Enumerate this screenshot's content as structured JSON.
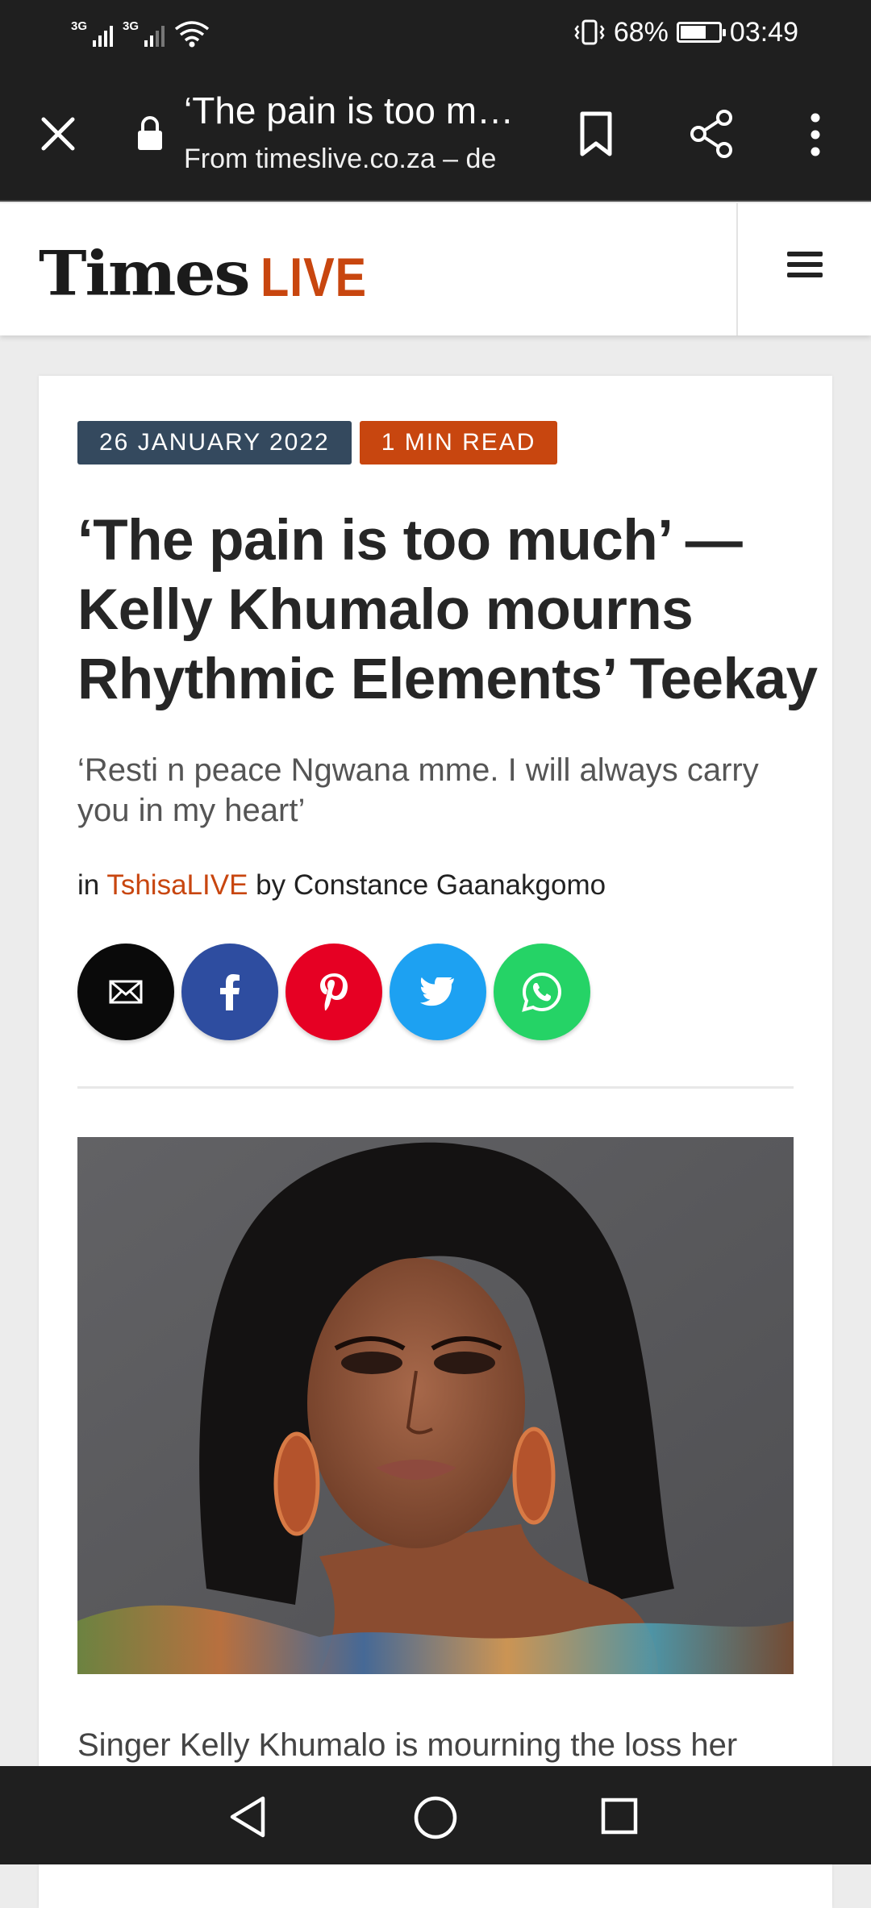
{
  "status_bar": {
    "signal1_label": "3G",
    "signal2_label": "3G",
    "battery_percent": "68%",
    "battery_level": 0.68,
    "time": "03:49",
    "icons": [
      "vibrate-icon",
      "battery-icon",
      "wifi-icon"
    ]
  },
  "browser": {
    "title": "‘The pain is too much’ — Kelly Khumalo mourns Rhythmic Elements’ Teekay",
    "url": "From timeslive.co.za – de",
    "icons": [
      "close-icon",
      "lock-icon",
      "bookmark-icon",
      "share-icon",
      "more-vert-icon"
    ]
  },
  "site": {
    "logo_times": "Times",
    "logo_live": "LIVE",
    "menu_icon": "hamburger-menu-icon"
  },
  "article": {
    "date_tag": "26 JANUARY 2022",
    "read_tag": "1 MIN READ",
    "headline": "‘The pain is too much’ — Kelly Khumalo mourns Rhythmic Elements’ Teekay",
    "subheadline": "‘Resti n peace Ngwana mme. I will always carry you in my heart’",
    "byline_in": "in",
    "section": "TshisaLIVE",
    "byline_by": "by",
    "author": "Constance Gaanakgomo",
    "body_start": "Singer Kelly Khumalo is mourning the loss her",
    "share_buttons": [
      "email-icon",
      "facebook-icon",
      "pinterest-icon",
      "twitter-icon",
      "whatsapp-icon"
    ]
  },
  "nav": {
    "icons": [
      "back-icon",
      "home-icon",
      "recent-apps-icon"
    ]
  },
  "colors": {
    "accent": "#c8460f",
    "date_tag": "#34495e",
    "facebook": "#2e4da0",
    "pinterest": "#e60023",
    "twitter": "#1da1f2",
    "whatsapp": "#25d366"
  }
}
